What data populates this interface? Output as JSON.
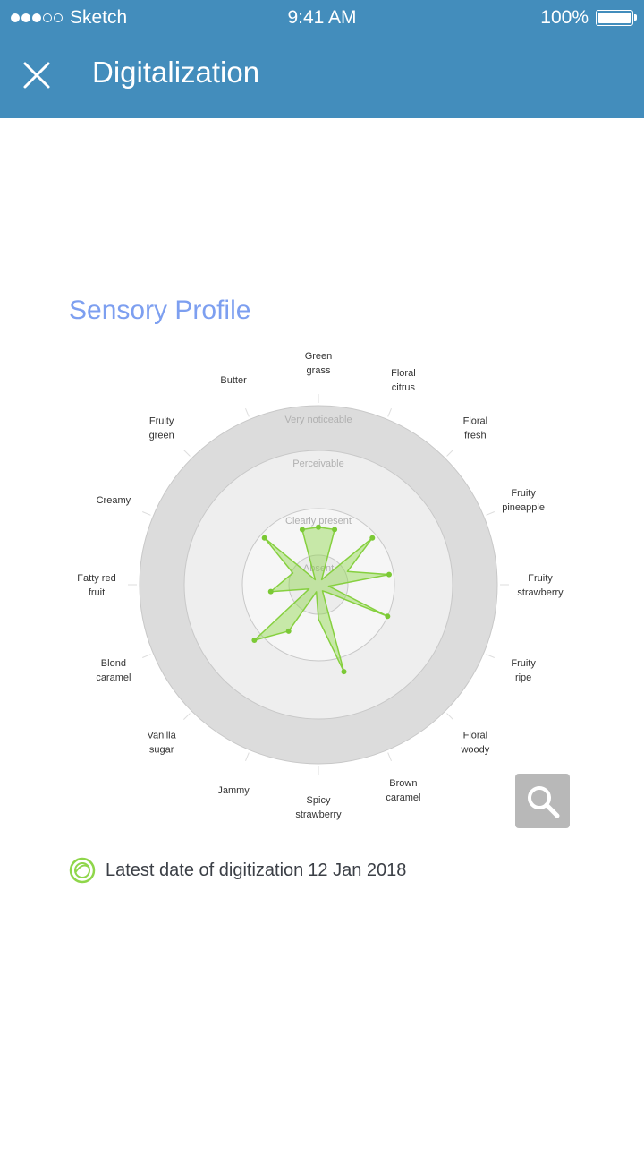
{
  "status_bar": {
    "carrier": "Sketch",
    "time": "9:41 AM",
    "battery": "100%"
  },
  "nav": {
    "title": "Digitalization"
  },
  "section_title": "Sensory Profile",
  "footer": {
    "label": "Latest date of digitization",
    "date": "12 Jan 2018"
  },
  "colors": {
    "header": "#438dbc",
    "accent": "#7d9ff0",
    "series": "#8fd64a"
  },
  "chart_data": {
    "type": "radar",
    "rings": [
      "Absent",
      "Clearly present",
      "Perceivable",
      "Very noticeable"
    ],
    "axes": [
      [
        "Green",
        "grass"
      ],
      [
        "Floral",
        "citrus"
      ],
      [
        "Floral",
        "fresh"
      ],
      [
        "Fruity",
        "pineapple"
      ],
      [
        "Fruity",
        "strawberry"
      ],
      [
        "Fruity",
        "ripe"
      ],
      [
        "Floral",
        "woody"
      ],
      [
        "Brown",
        "caramel"
      ],
      [
        "Spicy",
        "strawberry"
      ],
      [
        "Jammy"
      ],
      [
        "Vanilla",
        "sugar"
      ],
      [
        "Blond",
        "caramel"
      ],
      [
        "Fatty red",
        "fruit"
      ],
      [
        "Creamy"
      ],
      [
        "Fruity",
        "green"
      ],
      [
        "Butter"
      ]
    ],
    "series": [
      {
        "values": [
          1.6,
          1.6,
          0.2,
          1.9,
          1.05,
          1.9,
          0.35,
          2.0,
          0.4,
          0.25,
          2.25,
          1.1,
          0.25,
          1.55,
          2.15,
          0.35,
          1.4,
          1.1,
          0.95,
          1.9,
          0.2,
          1.6
        ]
      }
    ]
  }
}
